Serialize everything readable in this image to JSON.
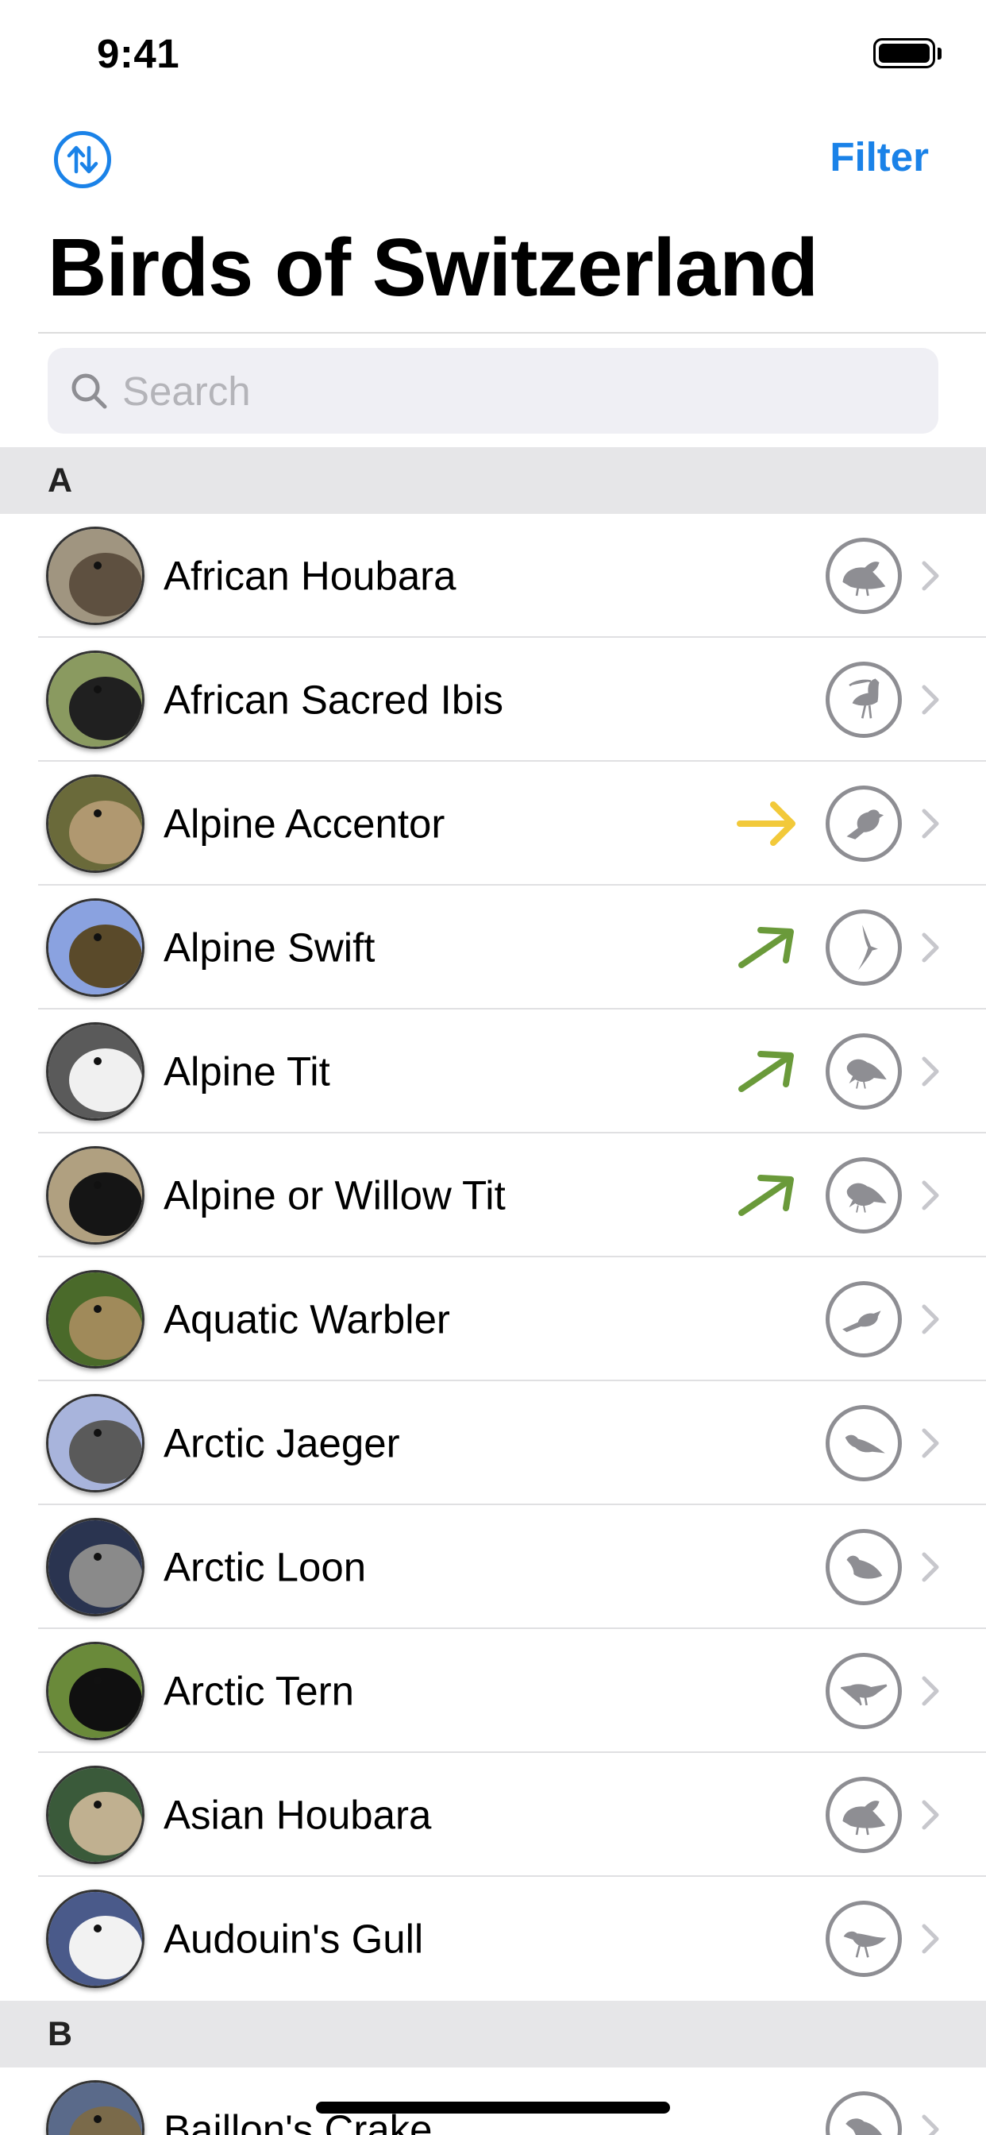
{
  "status_bar": {
    "time": "9:41"
  },
  "nav": {
    "filter_label": "Filter",
    "title": "Birds of Switzerland"
  },
  "search": {
    "placeholder": "Search"
  },
  "colors": {
    "accent": "#1a82e8",
    "trend_stable": "#f2c93a",
    "trend_up": "#6a9a3a",
    "icon_gray": "#8e8e93"
  },
  "sections": [
    {
      "letter": "A",
      "birds": [
        {
          "name": "African Houbara",
          "trend": "none",
          "icon": "bustard-silhouette-icon",
          "photo": [
            "#a09580",
            "#5e5040"
          ]
        },
        {
          "name": "African Sacred Ibis",
          "trend": "none",
          "icon": "ibis-silhouette-icon",
          "photo": [
            "#8a9a60",
            "#202020"
          ]
        },
        {
          "name": "Alpine Accentor",
          "trend": "stable",
          "icon": "songbird-silhouette-icon",
          "photo": [
            "#6a6a3a",
            "#b09870"
          ]
        },
        {
          "name": "Alpine Swift",
          "trend": "increase",
          "icon": "swift-silhouette-icon",
          "photo": [
            "#8aa2e0",
            "#5a4a2a"
          ]
        },
        {
          "name": "Alpine Tit",
          "trend": "increase",
          "icon": "tit-silhouette-icon",
          "photo": [
            "#5a5a5a",
            "#f0f0f0"
          ]
        },
        {
          "name": "Alpine or Willow Tit",
          "trend": "increase",
          "icon": "tit-silhouette-icon",
          "photo": [
            "#b0a080",
            "#151515"
          ]
        },
        {
          "name": "Aquatic Warbler",
          "trend": "none",
          "icon": "warbler-silhouette-icon",
          "photo": [
            "#4a6a2a",
            "#a08a5a"
          ]
        },
        {
          "name": "Arctic Jaeger",
          "trend": "none",
          "icon": "jaeger-silhouette-icon",
          "photo": [
            "#a8b4dc",
            "#5a5a5a"
          ]
        },
        {
          "name": "Arctic Loon",
          "trend": "none",
          "icon": "loon-silhouette-icon",
          "photo": [
            "#2a3450",
            "#8a8a8a"
          ]
        },
        {
          "name": "Arctic Tern",
          "trend": "none",
          "icon": "tern-silhouette-icon",
          "photo": [
            "#6a8a3a",
            "#101010"
          ]
        },
        {
          "name": "Asian Houbara",
          "trend": "none",
          "icon": "bustard-silhouette-icon",
          "photo": [
            "#3a5a3a",
            "#c0b090"
          ]
        },
        {
          "name": "Audouin's Gull",
          "trend": "none",
          "icon": "gull-silhouette-icon",
          "photo": [
            "#4a5a8a",
            "#f2f2f2"
          ]
        }
      ]
    },
    {
      "letter": "B",
      "birds": [
        {
          "name": "Baillon's Crake",
          "trend": "none",
          "icon": "crake-silhouette-icon",
          "photo": [
            "#5a6a8a",
            "#7a6a4a"
          ]
        }
      ]
    }
  ]
}
